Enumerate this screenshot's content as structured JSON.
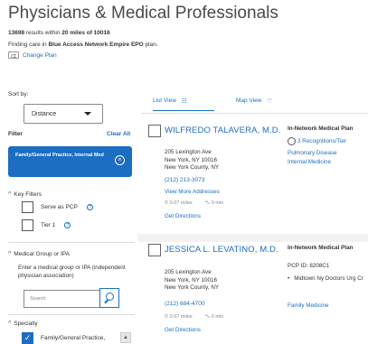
{
  "header": {
    "title": "Physicians & Medical Professionals",
    "results_count": "13698",
    "results_middle": "results within",
    "radius": "20 miles of 10016",
    "finding_prefix": "Finding care in",
    "plan_name": "Blue Access Network Empire EPO",
    "finding_suffix": "plan.",
    "change_plan": "Change Plan"
  },
  "sidebar": {
    "sort_label": "Sort by:",
    "sort_value": "Distance",
    "filter_label": "Filter",
    "clear_all": "Clear All",
    "active_filter": "Family/General Practice, Internal Med",
    "key_filters_label": "Key Filters",
    "key_filters": [
      "Serve as PCP",
      "Tier 1"
    ],
    "medical_group_label": "Medical Group or IPA",
    "medical_group_desc": "Enter a medical group or IPA (independent physician association)",
    "search_placeholder": "Search",
    "specialty_label": "Specialty",
    "specialty_option": "Family/General Practice,"
  },
  "view_tabs": {
    "list": "List View",
    "map": "Map View"
  },
  "doctors": [
    {
      "name": "WILFREDO TALAVERA, M.D.",
      "address_line1": "205 Lexington Ave",
      "address_line2": "New York, NY 10016",
      "address_line3": "New York County, NY",
      "phone": "(212) 213-3073",
      "more_addresses": "View More Addresses",
      "distance": "0.07 miles",
      "drive_time": "0 min",
      "directions": "Get Directions",
      "plan_header": "In-Network Medical Plan",
      "recognitions": "3 Recognitions/Tier",
      "specialties": [
        "Pulmonary Disease",
        "Internal Medicine"
      ]
    },
    {
      "name": "JESSICA L. LEVATINO, M.D.",
      "address_line1": "205 Lexington Ave",
      "address_line2": "New York, NY 10016",
      "address_line3": "New York County, NY",
      "phone": "(212) 684-4700",
      "distance": "0.07 miles",
      "drive_time": "0 min",
      "directions": "Get Directions",
      "plan_header": "In-Network Medical Plan",
      "pcp_id": "PCP ID: 8208C1",
      "group": "Midtown Ny Doctors Urg Cr",
      "specialties": [
        "Family Medicine"
      ]
    }
  ],
  "colors": {
    "accent": "#1b6ec2",
    "text": "#333333",
    "muted": "#888888"
  }
}
